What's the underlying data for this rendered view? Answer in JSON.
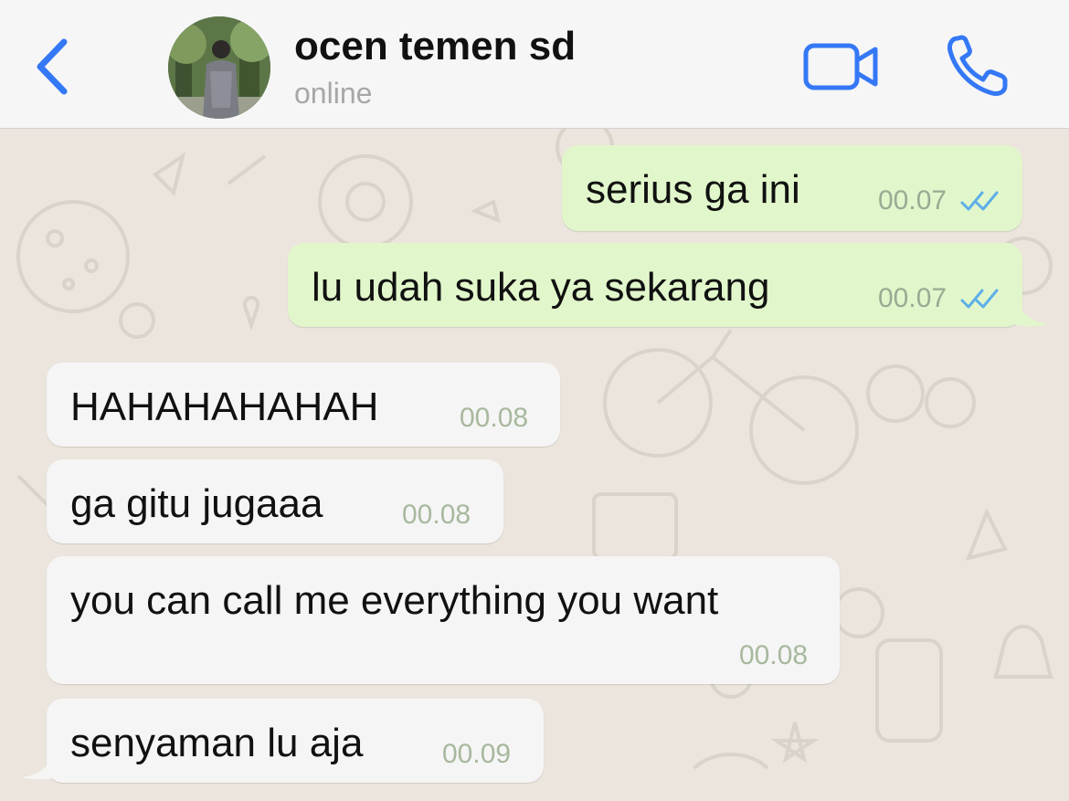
{
  "header": {
    "back_icon": "chevron-left-icon",
    "contact_name": "ocen temen sd",
    "contact_status": "online",
    "video_icon": "video-camera-icon",
    "call_icon": "phone-icon",
    "accent_color": "#3478f6"
  },
  "messages": [
    {
      "direction": "outgoing",
      "text": "serius ga ini",
      "time": "00.07",
      "read": true
    },
    {
      "direction": "outgoing",
      "text": "lu udah suka ya sekarang",
      "time": "00.07",
      "read": true
    },
    {
      "direction": "incoming",
      "text": "HAHAHAHAHAH",
      "time": "00.08"
    },
    {
      "direction": "incoming",
      "text": "ga gitu jugaaa",
      "time": "00.08"
    },
    {
      "direction": "incoming",
      "text": "you can call me everything you want",
      "time": "00.08"
    },
    {
      "direction": "incoming",
      "text": "senyaman lu aja",
      "time": "00.09"
    }
  ],
  "colors": {
    "outgoing_bubble": "#e1f7cb",
    "incoming_bubble": "#f5f5f5",
    "chat_background": "#ece5dd",
    "read_ticks": "#5eaee8"
  }
}
